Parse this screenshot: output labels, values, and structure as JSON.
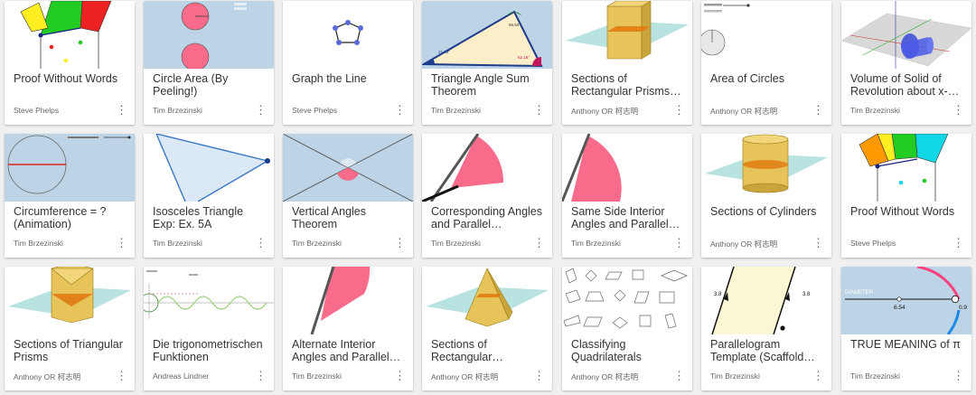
{
  "cards": [
    {
      "title": "Proof Without Words",
      "author": "Steve Phelps",
      "thumb": "pythagoras"
    },
    {
      "title": "Circle Area (By Peeling!)",
      "author": "Tim Brzezinski",
      "thumb": "circle-area"
    },
    {
      "title": "Graph the Line",
      "author": "Steve Phelps",
      "thumb": "pentagon"
    },
    {
      "title": "Triangle Angle Sum Theorem",
      "author": "Tim Brzezinski",
      "thumb": "triangle-sum",
      "labels": [
        "66.94°",
        "21.98°",
        "62.18°"
      ]
    },
    {
      "title": "Sections of Rectangular Prisms…",
      "author": "Anthony OR 柯志明",
      "thumb": "prism"
    },
    {
      "title": "Area of Circles",
      "author": "Anthony OR 柯志明",
      "thumb": "area-circles"
    },
    {
      "title": "Volume of Solid of Revolution about x-…",
      "author": "Tim Brzezinski",
      "thumb": "solid-revolution"
    },
    {
      "title": "Circumference = ? (Animation)",
      "author": "Tim Brzezinski",
      "thumb": "circumference"
    },
    {
      "title": "Isosceles Triangle Exp: Ex. 5A",
      "author": "Tim Brzezinski",
      "thumb": "isosceles"
    },
    {
      "title": "Vertical Angles Theorem",
      "author": "Tim Brzezinski",
      "thumb": "vertical-angles"
    },
    {
      "title": "Corresponding Angles and Parallel…",
      "author": "Tim Brzezinski",
      "thumb": "wedge-a"
    },
    {
      "title": "Same Side Interior Angles and Parallel…",
      "author": "Tim Brzezinski",
      "thumb": "wedge-b"
    },
    {
      "title": "Sections of Cylinders",
      "author": "Anthony OR 柯志明",
      "thumb": "cylinder"
    },
    {
      "title": "Proof Without Words",
      "author": "Steve Phelps",
      "thumb": "pythagoras-2"
    },
    {
      "title": "Sections of Triangular Prisms",
      "author": "Anthony OR 柯志明",
      "thumb": "tri-prism"
    },
    {
      "title": "Die trigonometrischen Funktionen",
      "author": "Andreas Lindner",
      "thumb": "trig"
    },
    {
      "title": "Alternate Interior Angles and Parallel…",
      "author": "Tim Brzezinski",
      "thumb": "wedge-c"
    },
    {
      "title": "Sections of Rectangular…",
      "author": "Anthony OR 柯志明",
      "thumb": "pyramid"
    },
    {
      "title": "Classifying Quadrilaterals",
      "author": "Anthony OR 柯志明",
      "thumb": "quadrilaterals"
    },
    {
      "title": "Parallelogram Template (Scaffold…",
      "author": "Tim Brzezinski",
      "thumb": "parallelogram",
      "labels": [
        "3.8",
        "3.8"
      ]
    },
    {
      "title": "TRUE MEANING of π",
      "author": "Tim Brzezinski",
      "thumb": "pi",
      "labels": [
        "DIAMETER",
        "6.54",
        "0.9"
      ]
    }
  ],
  "menu_glyph": "⋮",
  "colors": {
    "thumb_blue": "#bcd4e6",
    "wedge_pink": "#f86b8a",
    "plane_teal": "#a8dcd8",
    "prism_gold": "#d9b23a"
  }
}
